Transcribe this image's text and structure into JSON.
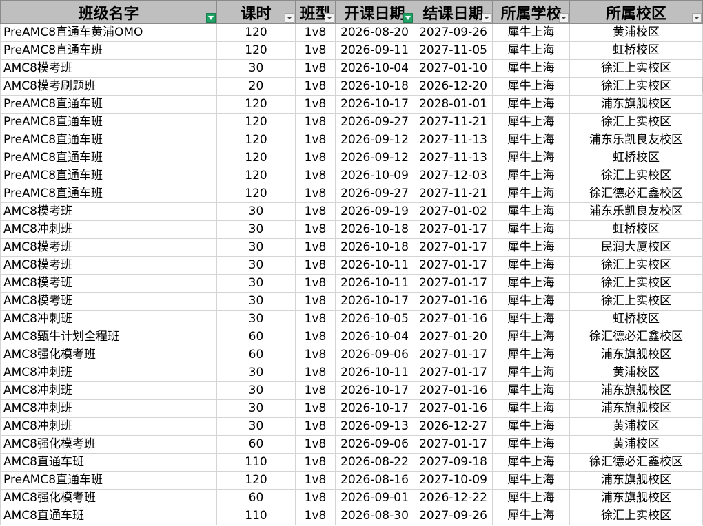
{
  "headers": [
    {
      "label": "班级名字",
      "filter": "active"
    },
    {
      "label": "课时",
      "filter": "dropdown"
    },
    {
      "label": "班型",
      "filter": "dropdown"
    },
    {
      "label": "开课日期",
      "filter": "active"
    },
    {
      "label": "结课日期",
      "filter": "dropdown"
    },
    {
      "label": "所属学校",
      "filter": "dropdown"
    },
    {
      "label": "所属校区",
      "filter": "dropdown"
    }
  ],
  "rows": [
    [
      "PreAMC8直通车黄浦OMO",
      "120",
      "1v8",
      "2026-08-20",
      "2027-09-26",
      "犀牛上海",
      "黄浦校区"
    ],
    [
      "PreAMC8直通车班",
      "120",
      "1v8",
      "2026-09-11",
      "2027-11-05",
      "犀牛上海",
      "虹桥校区"
    ],
    [
      "AMC8模考班",
      "30",
      "1v8",
      "2026-10-04",
      "2027-01-10",
      "犀牛上海",
      "徐汇上实校区"
    ],
    [
      "AMC8模考刷题班",
      "20",
      "1v8",
      "2026-10-18",
      "2026-12-20",
      "犀牛上海",
      "徐汇上实校区"
    ],
    [
      "PreAMC8直通车班",
      "120",
      "1v8",
      "2026-10-17",
      "2028-01-01",
      "犀牛上海",
      "浦东旗舰校区"
    ],
    [
      "PreAMC8直通车班",
      "120",
      "1v8",
      "2026-09-27",
      "2027-11-21",
      "犀牛上海",
      "徐汇上实校区"
    ],
    [
      "PreAMC8直通车班",
      "120",
      "1v8",
      "2026-09-12",
      "2027-11-13",
      "犀牛上海",
      "浦东乐凯良友校区"
    ],
    [
      "PreAMC8直通车班",
      "120",
      "1v8",
      "2026-09-12",
      "2027-11-13",
      "犀牛上海",
      "虹桥校区"
    ],
    [
      "PreAMC8直通车班",
      "120",
      "1v8",
      "2026-10-09",
      "2027-12-03",
      "犀牛上海",
      "徐汇上实校区"
    ],
    [
      "PreAMC8直通车班",
      "120",
      "1v8",
      "2026-09-27",
      "2027-11-21",
      "犀牛上海",
      "徐汇德必汇鑫校区"
    ],
    [
      "AMC8模考班",
      "30",
      "1v8",
      "2026-09-19",
      "2027-01-02",
      "犀牛上海",
      "浦东乐凯良友校区"
    ],
    [
      "AMC8冲刺班",
      "30",
      "1v8",
      "2026-10-18",
      "2027-01-17",
      "犀牛上海",
      "虹桥校区"
    ],
    [
      "AMC8模考班",
      "30",
      "1v8",
      "2026-10-18",
      "2027-01-17",
      "犀牛上海",
      "民润大厦校区"
    ],
    [
      "AMC8模考班",
      "30",
      "1v8",
      "2026-10-11",
      "2027-01-17",
      "犀牛上海",
      "徐汇上实校区"
    ],
    [
      "AMC8模考班",
      "30",
      "1v8",
      "2026-10-11",
      "2027-01-17",
      "犀牛上海",
      "徐汇上实校区"
    ],
    [
      "AMC8模考班",
      "30",
      "1v8",
      "2026-10-17",
      "2027-01-16",
      "犀牛上海",
      "徐汇上实校区"
    ],
    [
      "AMC8冲刺班",
      "30",
      "1v8",
      "2026-10-05",
      "2027-01-16",
      "犀牛上海",
      "虹桥校区"
    ],
    [
      "AMC8甄牛计划全程班",
      "60",
      "1v8",
      "2026-10-04",
      "2027-01-20",
      "犀牛上海",
      "徐汇德必汇鑫校区"
    ],
    [
      "AMC8强化模考班",
      "60",
      "1v8",
      "2026-09-06",
      "2027-01-17",
      "犀牛上海",
      "浦东旗舰校区"
    ],
    [
      "AMC8冲刺班",
      "30",
      "1v8",
      "2026-10-11",
      "2027-01-17",
      "犀牛上海",
      "黄浦校区"
    ],
    [
      "AMC8冲刺班",
      "30",
      "1v8",
      "2026-10-17",
      "2027-01-16",
      "犀牛上海",
      "浦东旗舰校区"
    ],
    [
      "AMC8冲刺班",
      "30",
      "1v8",
      "2026-10-17",
      "2027-01-16",
      "犀牛上海",
      "浦东旗舰校区"
    ],
    [
      "AMC8冲刺班",
      "30",
      "1v8",
      "2026-09-13",
      "2026-12-27",
      "犀牛上海",
      "黄浦校区"
    ],
    [
      "AMC8强化模考班",
      "60",
      "1v8",
      "2026-09-06",
      "2027-01-17",
      "犀牛上海",
      "黄浦校区"
    ],
    [
      "AMC8直通车班",
      "110",
      "1v8",
      "2026-08-22",
      "2027-09-18",
      "犀牛上海",
      "徐汇德必汇鑫校区"
    ],
    [
      "PreAMC8直通车班",
      "120",
      "1v8",
      "2026-08-16",
      "2027-10-09",
      "犀牛上海",
      "浦东旗舰校区"
    ],
    [
      "AMC8强化模考班",
      "60",
      "1v8",
      "2026-09-01",
      "2026-12-22",
      "犀牛上海",
      "浦东旗舰校区"
    ],
    [
      "AMC8直通车班",
      "110",
      "1v8",
      "2026-08-30",
      "2027-09-26",
      "犀牛上海",
      "徐汇上实校区"
    ]
  ]
}
